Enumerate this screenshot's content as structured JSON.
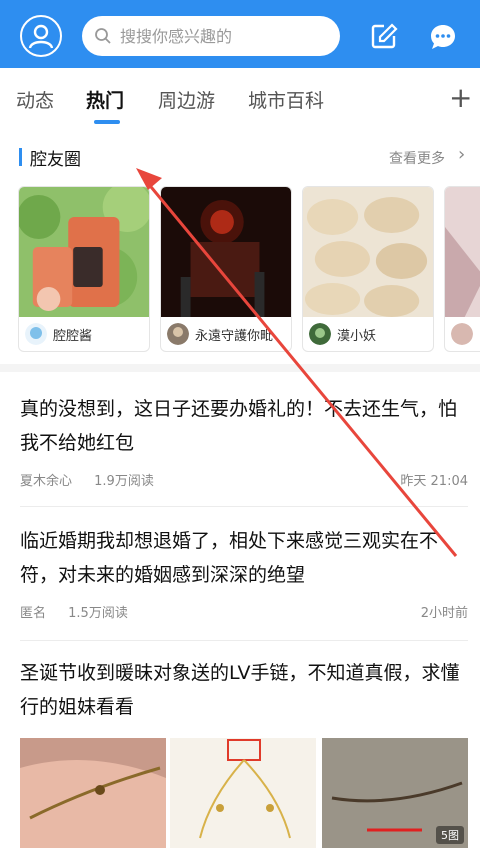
{
  "header": {
    "search_placeholder": "搜搜你感兴趣的",
    "accent_color": "#2e8ef0"
  },
  "tabs": [
    {
      "label": "动态"
    },
    {
      "label": "热门",
      "active": true
    },
    {
      "label": "周边游"
    },
    {
      "label": "城市百科"
    }
  ],
  "circle": {
    "title": "腔友圈",
    "see_more": "查看更多",
    "cards": [
      {
        "user": "腔腔酱"
      },
      {
        "user": "永遠守護你毗"
      },
      {
        "user": "漠小妖"
      },
      {
        "user": ""
      }
    ]
  },
  "posts": [
    {
      "title": "真的没想到，这日子还要办婚礼的！不去还生气，怕我不给她红包",
      "author": "夏木余心",
      "reads": "1.9万阅读",
      "time": "昨天 21:04"
    },
    {
      "title": "临近婚期我却想退婚了，相处下来感觉三观实在不符，对未来的婚姻感到深深的绝望",
      "author": "匿名",
      "reads": "1.5万阅读",
      "time": "2小时前"
    },
    {
      "title": "圣诞节收到暖昧对象送的LV手链，不知道真假，求懂行的姐妹看看",
      "image_count": "5图"
    }
  ]
}
